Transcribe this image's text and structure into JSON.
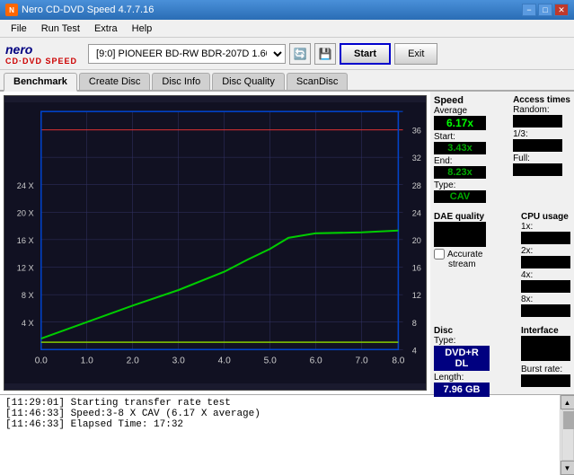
{
  "titlebar": {
    "title": "Nero CD-DVD Speed 4.7.7.16",
    "min_label": "−",
    "max_label": "□",
    "close_label": "✕"
  },
  "menubar": {
    "items": [
      "File",
      "Run Test",
      "Extra",
      "Help"
    ]
  },
  "toolbar": {
    "drive_value": "[9:0]  PIONEER BD-RW  BDR-207D 1.60",
    "start_label": "Start",
    "exit_label": "Exit"
  },
  "tabs": {
    "items": [
      "Benchmark",
      "Create Disc",
      "Disc Info",
      "Disc Quality",
      "ScanDisc"
    ]
  },
  "speed_panel": {
    "speed_label": "Speed",
    "average_label": "Average",
    "average_value": "6.17x",
    "start_label": "Start:",
    "start_value": "3.43x",
    "end_label": "End:",
    "end_value": "8.23x",
    "type_label": "Type:",
    "type_value": "CAV"
  },
  "access_panel": {
    "label": "Access times",
    "random_label": "Random:",
    "one_third_label": "1/3:",
    "full_label": "Full:"
  },
  "cpu_panel": {
    "label": "CPU usage",
    "one_label": "1x:",
    "two_label": "2x:",
    "four_label": "4x:",
    "eight_label": "8x:"
  },
  "dae_panel": {
    "label": "DAE quality",
    "accurate_label": "Accurate",
    "stream_label": "stream"
  },
  "disc_panel": {
    "disc_label": "Disc",
    "type_label": "Type:",
    "disc_type_value": "DVD+R DL",
    "length_label": "Length:",
    "length_value": "7.96 GB",
    "interface_label": "Interface",
    "burst_label": "Burst rate:"
  },
  "chart": {
    "x_labels": [
      "0.0",
      "1.0",
      "2.0",
      "3.0",
      "4.0",
      "5.0",
      "6.0",
      "7.0",
      "8.0"
    ],
    "y_labels_left": [
      "4 X",
      "8 X",
      "12 X",
      "16 X",
      "20 X",
      "24 X"
    ],
    "y_labels_right": [
      "4",
      "8",
      "12",
      "16",
      "20",
      "24",
      "28",
      "32",
      "36"
    ]
  },
  "log": {
    "entries": [
      "[11:29:01]  Starting transfer rate test",
      "[11:46:33]  Speed:3-8 X CAV (6.17 X average)",
      "[11:46:33]  Elapsed Time: 17:32"
    ]
  }
}
